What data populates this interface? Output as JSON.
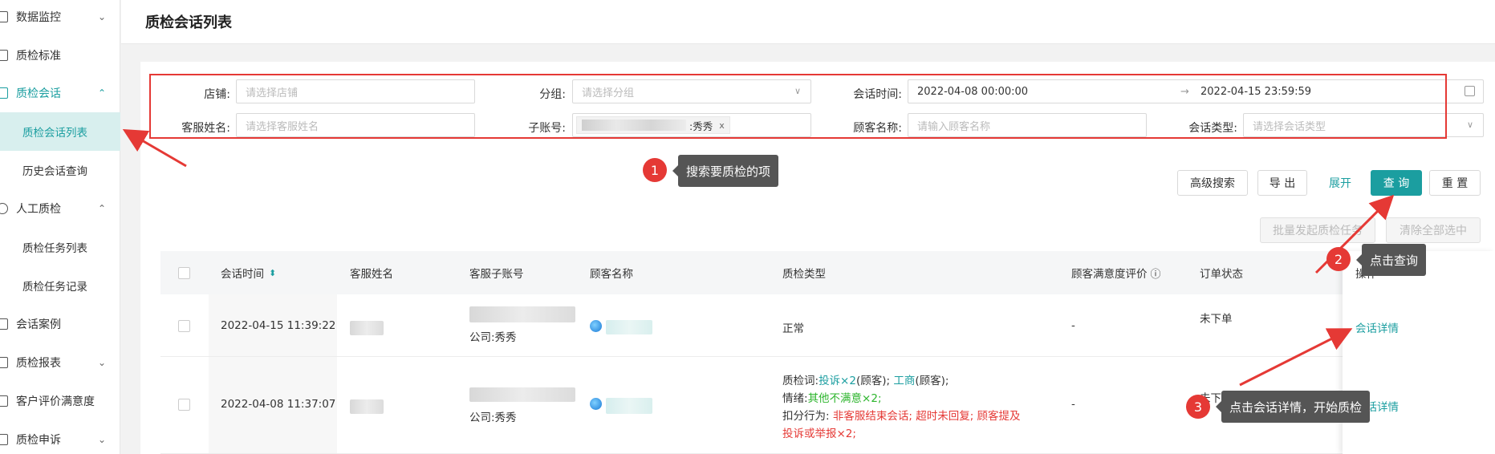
{
  "sidebar": {
    "items": [
      {
        "label": "数据监控",
        "icon": "chart-icon",
        "chevron": "⌄"
      },
      {
        "label": "质检标准",
        "icon": "document-icon"
      },
      {
        "label": "质检会话",
        "icon": "chat-icon",
        "chevron": "⌃"
      },
      {
        "label": "质检会话列表"
      },
      {
        "label": "历史会话查询"
      },
      {
        "label": "人工质检",
        "icon": "user-icon",
        "chevron": "⌃"
      },
      {
        "label": "质检任务列表"
      },
      {
        "label": "质检任务记录"
      },
      {
        "label": "会话案例",
        "icon": "layers-icon"
      },
      {
        "label": "质检报表",
        "icon": "report-icon",
        "chevron": "⌄"
      },
      {
        "label": "客户评价满意度",
        "icon": "star-icon"
      },
      {
        "label": "质检申诉",
        "icon": "appeal-icon",
        "chevron": "⌄"
      }
    ]
  },
  "header": {
    "title": "质检会话列表"
  },
  "filters": {
    "shop_label": "店铺:",
    "shop_placeholder": "请选择店铺",
    "group_label": "分组:",
    "group_placeholder": "请选择分组",
    "time_label": "会话时间:",
    "time_start": "2022-04-08 00:00:00",
    "time_sep": "→",
    "time_end": "2022-04-15 23:59:59",
    "agent_label": "客服姓名:",
    "agent_placeholder": "请选择客服姓名",
    "subaccount_label": "子账号:",
    "subaccount_chip": ":秀秀",
    "subaccount_chip_close": "x",
    "customer_label": "顾客名称:",
    "customer_placeholder": "请输入顾客名称",
    "type_label": "会话类型:",
    "type_placeholder": "请选择会话类型"
  },
  "buttons": {
    "advanced": "高级搜索",
    "export": "导 出",
    "expand": "展开",
    "query": "查 询",
    "reset": "重 置",
    "batch": "批量发起质检任务",
    "clear_selected": "清除全部选中"
  },
  "table": {
    "columns": [
      "会话时间",
      "客服姓名",
      "客服子账号",
      "顾客名称",
      "质检类型",
      "顾客满意度评价",
      "订单状态",
      "操作"
    ],
    "sort_glyph": "⬍",
    "info_glyph": "ⓘ",
    "rows": [
      {
        "time": "2022-04-15 11:39:22",
        "subaccount": "公司:秀秀",
        "qc_type": "正常",
        "satisfaction": "-",
        "order_status": "未下单",
        "action": "会话详情"
      },
      {
        "time": "2022-04-08 11:37:07",
        "subaccount": "公司:秀秀",
        "qc_line1_prefix": "质检词:",
        "qc_line1_kw1": "投诉×2",
        "qc_line1_mid": "(顾客);",
        "qc_line1_kw2": "工商",
        "qc_line1_suffix": "(顾客);",
        "qc_line2_prefix": "情绪:",
        "qc_line2_kw": "其他不满意×2",
        "qc_line2_suffix": ";",
        "qc_line3_prefix": "扣分行为:",
        "qc_line3_text": "非客服结束会话; 超时未回复; 顾客提及",
        "qc_line4_text": "投诉或举报×2;",
        "satisfaction": "-",
        "order_status": "未下单",
        "action": "会话详情"
      }
    ]
  },
  "annotations": {
    "step1_num": "1",
    "step1_text": "搜索要质检的项",
    "step2_num": "2",
    "step2_text": "点击查询",
    "step3_num": "3",
    "step3_text": "点击会话详情，开始质检"
  },
  "colors": {
    "accent": "#1b9ea0",
    "annotation_red": "#e53935"
  }
}
